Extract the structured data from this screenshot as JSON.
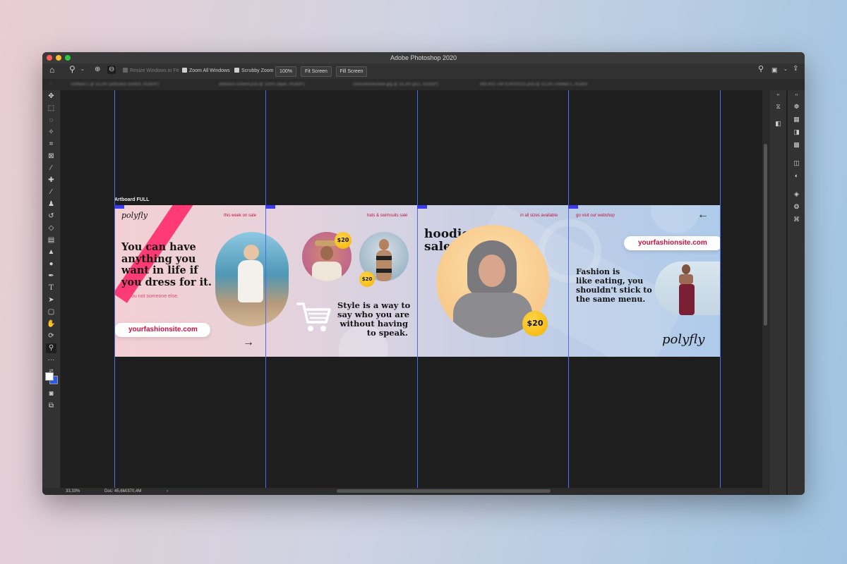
{
  "window": {
    "title": "Adobe Photoshop 2020",
    "traffic_colors": [
      "#fe5f57",
      "#febc2e",
      "#28c840"
    ]
  },
  "options_bar": {
    "resize_windows": "Resize Windows to Fit",
    "zoom_all_windows": "Zoom All Windows",
    "scrubby_zoom": "Scrubby Zoom",
    "zoom_value": "100%",
    "fit_screen": "Fit Screen",
    "fill_screen": "Fill Screen"
  },
  "tabs": [
    "Untitled-1 @ 33,3% (artboard content, RGB/8*)",
    "artboard content.psd @ 100% (layer, RGB/8*)",
    "colorsetoneuneer.jpg @ 33,3% (ps1, RGB/8*)",
    "889.602-789 ICR000101.psd @ 33,3% Untitled-1, RGB/8"
  ],
  "statusbar": {
    "zoom": "33,33%",
    "doc": "Doc: 45,6M/370,4M",
    "arrow": "›"
  },
  "canvas": {
    "artboard_label": "Artboard FULL",
    "guide_color": "#4a6cf0"
  },
  "design": {
    "logo": "polyfly",
    "panel1": {
      "tag": "this week on sale",
      "headline": [
        "You can have",
        "anything you",
        "want in life if",
        "you dress for it."
      ],
      "subline": "Be you not someone else.",
      "url": "yourfashionsite.com",
      "arrow": "→"
    },
    "panel2": {
      "tag": "hats & swimsuits sale",
      "price_a": "$20",
      "price_b": "$20",
      "quote": [
        "Style is a way to",
        "say who you are",
        "without having",
        "to speak."
      ]
    },
    "panel3": {
      "tag": "in all sizes available",
      "headline": [
        "hoodies",
        "sale."
      ],
      "price": "$20"
    },
    "panel4": {
      "tag": "go visit our webshop",
      "arrow": "←",
      "url": "yourfashionsite.com",
      "quote": [
        "Fashion is",
        "like eating, you",
        "shouldn't stick to",
        "the same menu."
      ],
      "logo": "polyfly"
    },
    "colors": {
      "accent_pink": "#ff3a74",
      "accent_red": "#c8103e",
      "badge_yellow": "#f3b300"
    }
  }
}
